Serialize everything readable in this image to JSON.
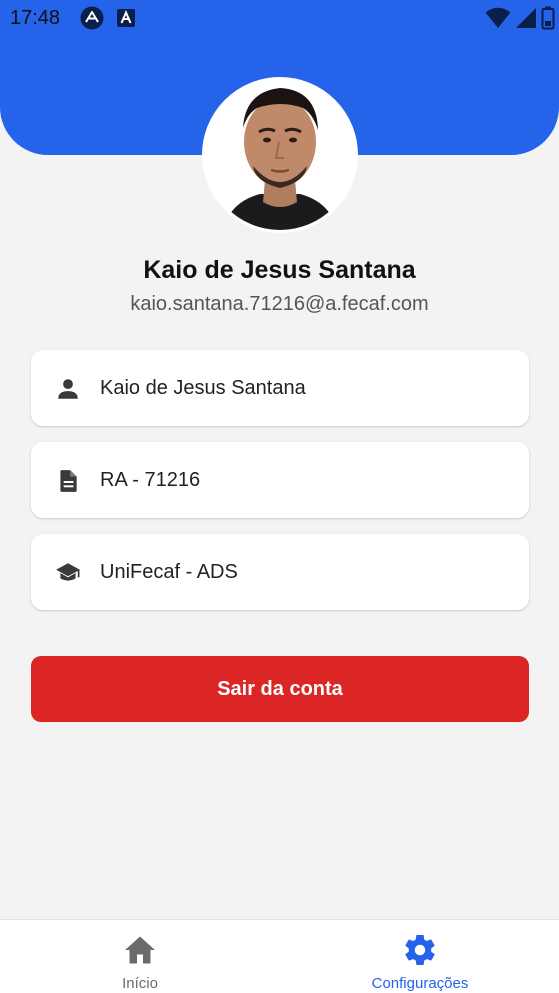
{
  "status_bar": {
    "time": "17:48"
  },
  "profile": {
    "name": "Kaio de Jesus Santana",
    "email": "kaio.santana.71216@a.fecaf.com"
  },
  "info_cards": [
    {
      "icon": "person-icon",
      "text": "Kaio de Jesus Santana"
    },
    {
      "icon": "document-icon",
      "text": "RA - 71216"
    },
    {
      "icon": "graduation-cap-icon",
      "text": "UniFecaf - ADS"
    }
  ],
  "logout": {
    "label": "Sair da conta"
  },
  "bottom_nav": {
    "items": [
      {
        "label": "Início",
        "icon": "home-icon",
        "active": false
      },
      {
        "label": "Configurações",
        "icon": "gear-icon",
        "active": true
      }
    ]
  },
  "colors": {
    "primary": "#2563eb",
    "danger": "#dc2626",
    "nav_inactive": "#6b6b6b"
  }
}
